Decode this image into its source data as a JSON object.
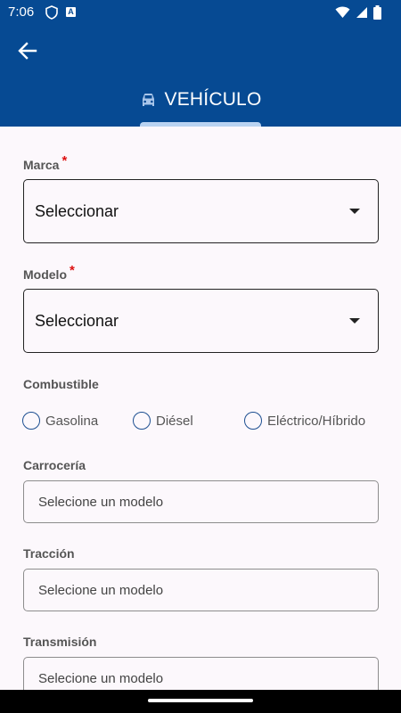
{
  "status_bar": {
    "time": "7:06",
    "icons": [
      "shield-icon",
      "a-badge-icon",
      "wifi-icon",
      "signal-icon",
      "battery-icon"
    ]
  },
  "header": {
    "back_icon": "arrow-back-icon",
    "title_icon": "car-icon",
    "title": "VEHÍCULO",
    "color": "#064a93",
    "indicator_color": "#b9d3f2"
  },
  "form": {
    "marca": {
      "label": "Marca",
      "required_mark": "*",
      "value": "Seleccionar"
    },
    "modelo": {
      "label": "Modelo",
      "required_mark": "*",
      "value": "Seleccionar"
    },
    "combustible": {
      "label": "Combustible",
      "options": [
        "Gasolina",
        "Diésel",
        "Eléctrico/Híbrido"
      ]
    },
    "carroceria": {
      "label": "Carrocería",
      "placeholder": "Selecione un modelo"
    },
    "traccion": {
      "label": "Tracción",
      "placeholder": "Selecione un modelo"
    },
    "transmision": {
      "label": "Transmisión",
      "placeholder": "Selecione un modelo"
    }
  }
}
